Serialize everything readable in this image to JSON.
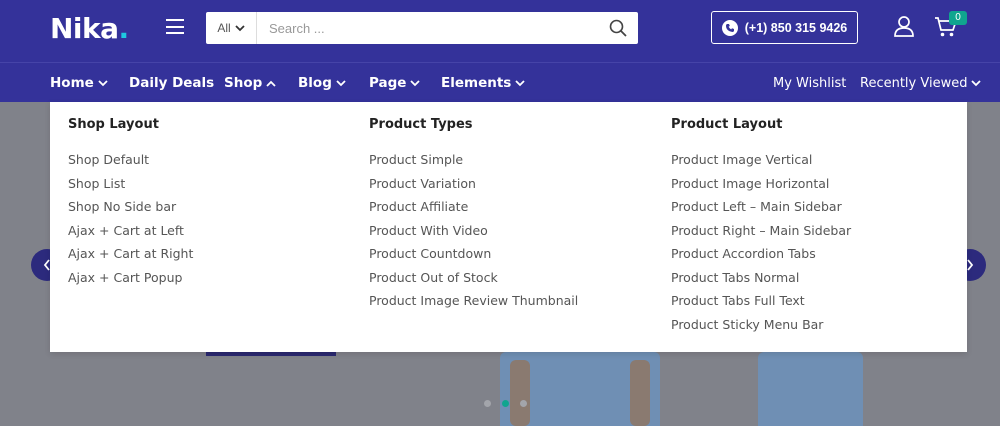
{
  "header": {
    "logo_text": "Nika",
    "logo_dot": ".",
    "search": {
      "category": "All",
      "placeholder": "Search ..."
    },
    "phone": "(+1) 850 315 9426",
    "cart_count": "0"
  },
  "nav": {
    "home": "Home",
    "daily_deals": "Daily Deals",
    "shop": "Shop",
    "blog": "Blog",
    "page": "Page",
    "elements": "Elements",
    "wishlist": "My Wishlist",
    "recently_viewed": "Recently Viewed"
  },
  "mega_menu": {
    "columns": [
      {
        "title": "Shop Layout",
        "items": [
          "Shop Default",
          "Shop List",
          "Shop No Side bar",
          "Ajax + Cart at Left",
          "Ajax + Cart at Right",
          "Ajax + Cart Popup"
        ]
      },
      {
        "title": "Product Types",
        "items": [
          "Product Simple",
          "Product Variation",
          "Product Affiliate",
          "Product With Video",
          "Product Countdown",
          "Product Out of Stock",
          "Product Image Review Thumbnail"
        ]
      },
      {
        "title": "Product Layout",
        "items": [
          "Product Image Vertical",
          "Product Image Horizontal",
          "Product Left – Main Sidebar",
          "Product Right – Main Sidebar",
          "Product Accordion Tabs",
          "Product Tabs Normal",
          "Product Tabs Full Text",
          "Product Sticky Menu Bar"
        ]
      }
    ]
  },
  "slider": {
    "active_dot": 2,
    "dot_count": 3
  },
  "colors": {
    "brand": "#34329a",
    "accent": "#10a58f",
    "logo_dot": "#1ec8e0"
  }
}
